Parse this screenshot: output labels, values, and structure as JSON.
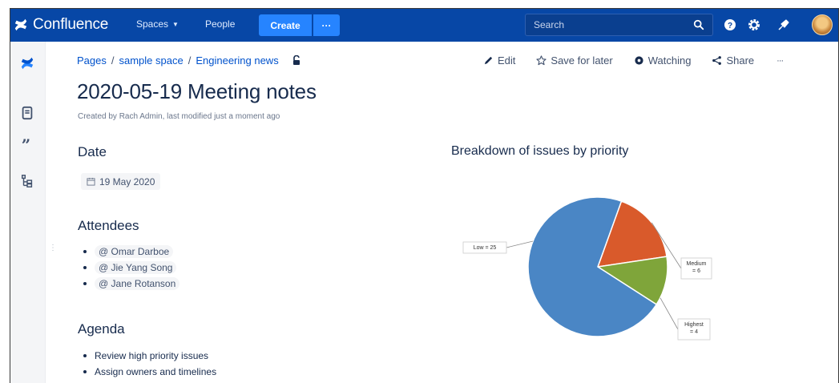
{
  "topbar": {
    "product_name": "Confluence",
    "nav_spaces": "Spaces",
    "nav_people": "People",
    "create_label": "Create",
    "more_label": "···",
    "search_placeholder": "Search",
    "accent": "#0747a6",
    "button_color": "#2684ff"
  },
  "sidebar": {
    "icons": [
      "confluence-logo-icon",
      "pages-icon",
      "quote-icon",
      "tree-icon"
    ]
  },
  "breadcrumb": {
    "items": [
      "Pages",
      "sample space",
      "Engineering news"
    ],
    "separator": "/"
  },
  "actions": {
    "edit": "Edit",
    "save_for_later": "Save for later",
    "watching": "Watching",
    "share": "Share",
    "more": "···"
  },
  "page": {
    "title": "2020-05-19 Meeting notes",
    "byline": "Created by Rach Admin, last modified just a moment ago"
  },
  "sections": {
    "date_heading": "Date",
    "date_value": "19 May 2020",
    "attendees_heading": "Attendees",
    "attendees": [
      "@ Omar Darboe",
      "@ Jie Yang Song",
      "@ Jane Rotanson"
    ],
    "agenda_heading": "Agenda",
    "agenda": [
      "Review high priority issues",
      "Assign owners and timelines"
    ]
  },
  "chart_data": {
    "type": "pie",
    "title": "Breakdown of issues by priority",
    "slices": [
      {
        "name": "Low",
        "value": 25,
        "color": "#4a86c5",
        "label": "Low = 25"
      },
      {
        "name": "Medium",
        "value": 6,
        "color": "#d95a2b",
        "label_line1": "Medium",
        "label_line2": "= 6"
      },
      {
        "name": "Highest",
        "value": 4,
        "color": "#7fa53a",
        "label_line1": "Highest",
        "label_line2": "= 4"
      }
    ]
  }
}
